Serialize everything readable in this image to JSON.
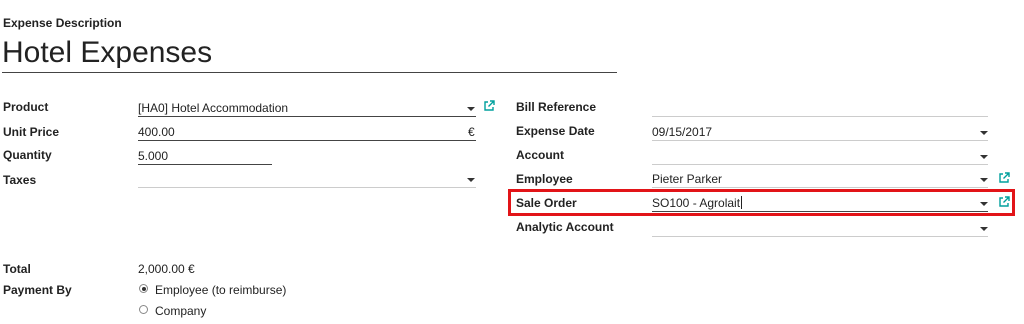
{
  "header": {
    "description_label": "Expense Description",
    "title": "Hotel Expenses"
  },
  "left": {
    "product": {
      "label": "Product",
      "value": "[HA0] Hotel Accommodation"
    },
    "unit_price": {
      "label": "Unit Price",
      "value": "400.00",
      "currency": "€"
    },
    "quantity": {
      "label": "Quantity",
      "value": "5.000"
    },
    "taxes": {
      "label": "Taxes",
      "value": ""
    }
  },
  "right": {
    "bill_reference": {
      "label": "Bill Reference",
      "value": ""
    },
    "expense_date": {
      "label": "Expense Date",
      "value": "09/15/2017"
    },
    "account": {
      "label": "Account",
      "value": ""
    },
    "employee": {
      "label": "Employee",
      "value": "Pieter Parker"
    },
    "sale_order": {
      "label": "Sale Order",
      "value": "SO100 - Agrolait"
    },
    "analytic_account": {
      "label": "Analytic Account",
      "value": ""
    }
  },
  "totals": {
    "total_label": "Total",
    "total_value": "2,000.00 €",
    "payment_by_label": "Payment By",
    "options": [
      {
        "label": "Employee (to reimburse)",
        "selected": true
      },
      {
        "label": "Company",
        "selected": false
      }
    ]
  },
  "colors": {
    "highlight": "#e21418",
    "link_icon": "#00a09d"
  },
  "icons": {
    "external_link": "external-link-icon",
    "dropdown": "caret-down-icon"
  }
}
